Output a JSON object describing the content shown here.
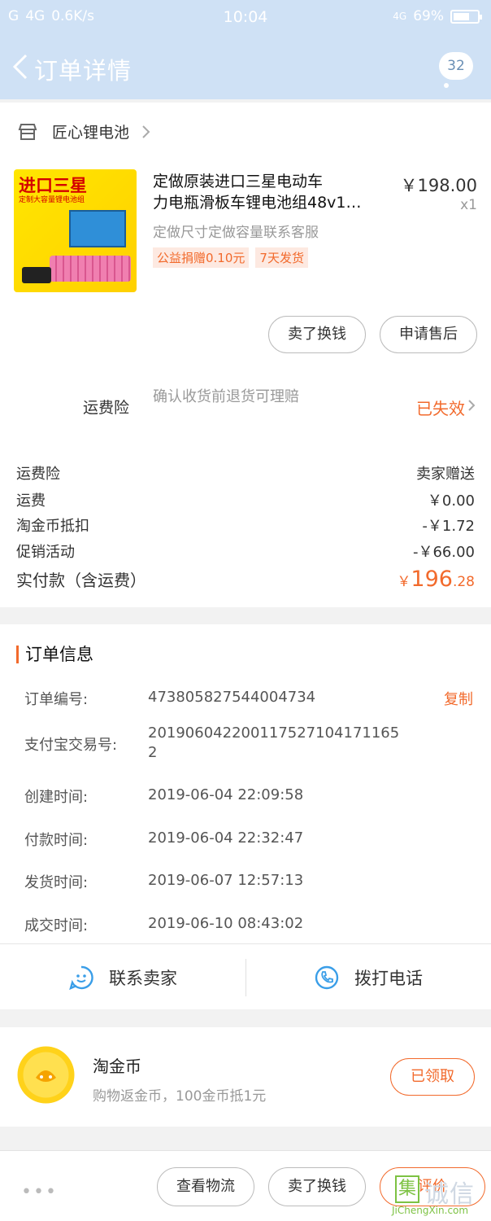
{
  "statusbar": {
    "signal": "G",
    "network": "4G",
    "speed": "0.6K/s",
    "time": "10:04",
    "network2": "4G",
    "battery": "69%",
    "battery_level": 0.69
  },
  "navbar": {
    "title": "订单详情",
    "badge": "32"
  },
  "shop": {
    "name": "匠心锂电池"
  },
  "product": {
    "thumb_title": "进口三星",
    "thumb_sub": "定制大容量锂电池组",
    "title_line1": "定做原装进口三星电动车",
    "title_line2": "力电瓶滑板车锂电池组48v1…",
    "price": "￥198.00",
    "qty": "x1",
    "spec": "定做尺寸定做容量联系客服",
    "tags": [
      "公益捐赠0.10元",
      "7天发货"
    ]
  },
  "actions": {
    "exchange": "卖了换钱",
    "aftersale": "申请售后"
  },
  "insurance": {
    "label": "运费险",
    "desc": "确认收货前退货可理赔",
    "status": "已失效"
  },
  "fees": [
    {
      "label": "运费险",
      "value": "卖家赠送"
    },
    {
      "label": "运费",
      "value": "￥0.00"
    },
    {
      "label": "淘金币抵扣",
      "value": "-￥1.72"
    },
    {
      "label": "促销活动",
      "value": "-￥66.00"
    }
  ],
  "total": {
    "label": "实付款（含运费）",
    "currency": "￥",
    "integer": "196",
    "decimal": ".28"
  },
  "order_info": {
    "title": "订单信息",
    "copy": "复制",
    "rows": [
      {
        "key": "订单编号:",
        "value": "473805827544004734"
      },
      {
        "key": "支付宝交易号:",
        "value": "201906042200117527104171165",
        "value2": "2"
      },
      {
        "key": "创建时间:",
        "value": "2019-06-04 22:09:58"
      },
      {
        "key": "付款时间:",
        "value": "2019-06-04 22:32:47"
      },
      {
        "key": "发货时间:",
        "value": "2019-06-07 12:57:13"
      },
      {
        "key": "成交时间:",
        "value": "2019-06-10 08:43:02"
      }
    ]
  },
  "contact": {
    "seller": "联系卖家",
    "phone": "拨打电话"
  },
  "coin": {
    "title": "淘金币",
    "sub": "购物返金币，100金币抵1元",
    "button": "已领取"
  },
  "bottombar": {
    "more": "•••",
    "logistics": "查看物流",
    "exchange": "卖了换钱",
    "review": "评价"
  },
  "watermark": {
    "char": "集",
    "text": "诚信",
    "url": "JiChengXin.com"
  },
  "colors": {
    "accent": "#f26a2c",
    "navbar": "#cfe1f5",
    "link_blue": "#3a9ee8"
  }
}
